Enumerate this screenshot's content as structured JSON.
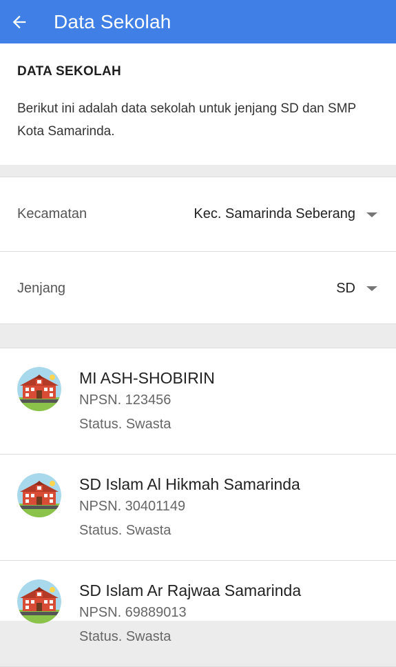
{
  "appbar": {
    "title": "Data Sekolah",
    "back_icon": "arrow-left-icon",
    "color": "#3f7fe6"
  },
  "intro": {
    "heading": "DATA SEKOLAH",
    "description": "Berikut ini adalah data sekolah untuk jenjang SD dan SMP Kota Samarinda."
  },
  "filters": {
    "kecamatan": {
      "label": "Kecamatan",
      "value": "Kec. Samarinda Seberang"
    },
    "jenjang": {
      "label": "Jenjang",
      "value": "SD"
    }
  },
  "schools": [
    {
      "name": "MI ASH-SHOBIRIN",
      "npsn": "NPSN. 123456",
      "status": "Status. Swasta",
      "icon": "school-building-icon"
    },
    {
      "name": "SD Islam Al Hikmah Samarinda",
      "npsn": "NPSN. 30401149",
      "status": "Status. Swasta",
      "icon": "school-building-icon"
    },
    {
      "name": "SD Islam Ar Rajwaa Samarinda",
      "npsn": "NPSN. 69889013",
      "status": "Status. Swasta",
      "icon": "school-building-icon"
    }
  ]
}
